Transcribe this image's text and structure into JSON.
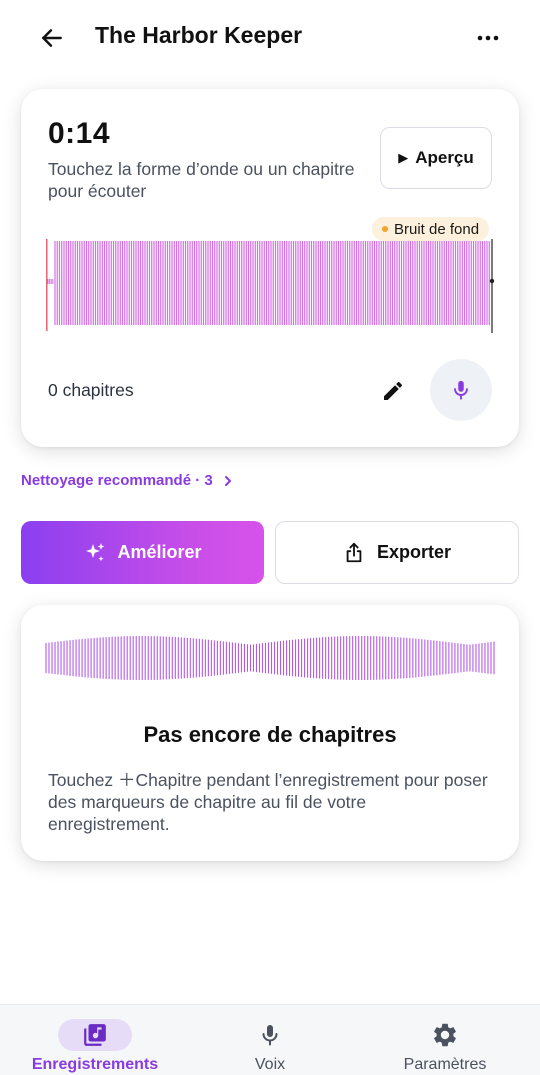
{
  "header": {
    "title": "The Harbor Keeper",
    "back_icon": "arrow-left-icon",
    "more_icon": "more-horizontal-icon"
  },
  "player": {
    "time": "0:14",
    "hint": "Touchez la forme d’onde ou un chapitre pour écouter",
    "preview_label": "Aperçu",
    "preview_icon": "play-icon",
    "noise_badge": "Bruit de fond",
    "chapters_count": "0 chapitres",
    "edit_icon": "pencil-icon",
    "mic_icon": "microphone-icon"
  },
  "cleanup": {
    "label": "Nettoyage recommandé · 3"
  },
  "actions": {
    "improve_label": "Améliorer",
    "improve_icon": "sparkles-icon",
    "export_label": "Exporter",
    "export_icon": "share-icon"
  },
  "empty_state": {
    "title": "Pas encore de chapitres",
    "text": "Touchez ＋Chapitre pendant l’enregistrement pour poser des marqueurs de chapitre au fil de votre enregistrement."
  },
  "nav": {
    "items": [
      {
        "label": "Enregistrements",
        "icon": "recordings-icon",
        "active": true
      },
      {
        "label": "Voix",
        "icon": "microphone-icon",
        "active": false
      },
      {
        "label": "Paramètres",
        "icon": "gear-icon",
        "active": false
      }
    ]
  },
  "colors": {
    "accent": "#8a3be0",
    "waveform": "#d46fe6",
    "badge_bg": "#fdf0dc",
    "badge_dot": "#f3a32a"
  }
}
